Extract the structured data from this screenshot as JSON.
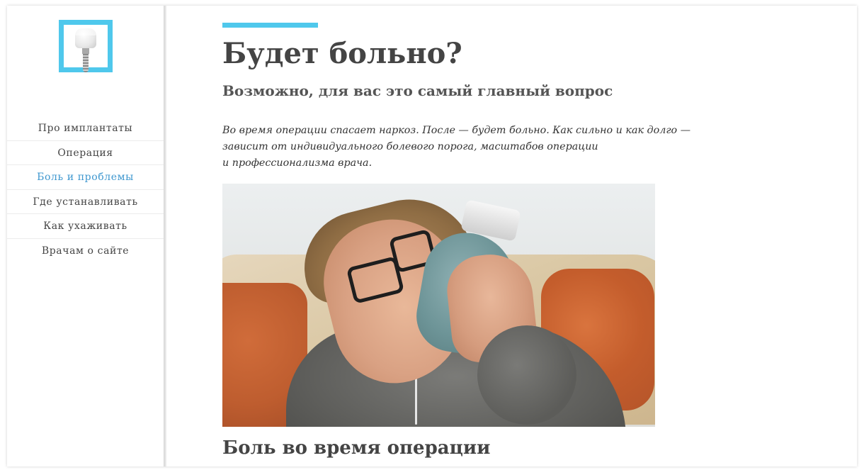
{
  "sidebar": {
    "logo_icon": "dental-implant-tooth-icon",
    "accent_color": "#4fc8ec",
    "nav": [
      {
        "label": "Про имплантаты",
        "active": false
      },
      {
        "label": "Операция",
        "active": false
      },
      {
        "label": "Боль и проблемы",
        "active": true
      },
      {
        "label": "Где устанавливать",
        "active": false
      },
      {
        "label": "Как ухаживать",
        "active": false
      },
      {
        "label": "Врачам о сайте",
        "active": false
      }
    ],
    "active_color": "#3e97cf"
  },
  "main": {
    "title": "Будет больно?",
    "subtitle": "Возможно, для вас это самый главный вопрос",
    "lead_lines": [
      "Во время операции спасает наркоз. После — будет больно. Как сильно и как долго —",
      "зависит от индивидуального болевого порога, масштабов операции",
      "и профессионализма врача."
    ],
    "section_heading": "Боль во время операции"
  }
}
